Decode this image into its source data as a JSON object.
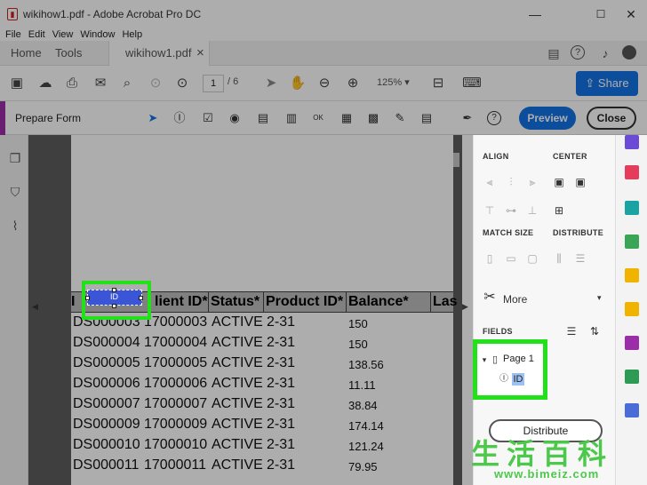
{
  "window": {
    "title": "wikihow1.pdf - Adobe Acrobat Pro DC",
    "minimize": "—",
    "maximize": "☐",
    "close": "✕"
  },
  "menu": [
    "File",
    "Edit",
    "View",
    "Window",
    "Help"
  ],
  "tabs": {
    "home": "Home",
    "tools": "Tools",
    "doc": "wikihow1.pdf",
    "doc_close": "×"
  },
  "toolbar": {
    "page_current": "1",
    "page_total": "/ 6",
    "zoom": "125%",
    "share": "Share"
  },
  "prepare": {
    "label": "Prepare Form",
    "preview": "Preview",
    "close": "Close"
  },
  "table": {
    "headers": [
      "ID",
      "Client ID*",
      "Status*",
      "Product ID*",
      "Balance*",
      "Las"
    ],
    "header_visible": {
      "client": "lient ID*",
      "first": "I"
    },
    "rows": [
      [
        "DS000003",
        "17000003",
        "ACTIVE",
        "2-31",
        "150"
      ],
      [
        "DS000004",
        "17000004",
        "ACTIVE",
        "2-31",
        "150"
      ],
      [
        "DS000005",
        "17000005",
        "ACTIVE",
        "2-31",
        "138.56"
      ],
      [
        "DS000006",
        "17000006",
        "ACTIVE",
        "2-31",
        "11.11"
      ],
      [
        "DS000007",
        "17000007",
        "ACTIVE",
        "2-31",
        "38.84"
      ],
      [
        "DS000009",
        "17000009",
        "ACTIVE",
        "2-31",
        "174.14"
      ],
      [
        "DS000010",
        "17000010",
        "ACTIVE",
        "2-31",
        "121.24"
      ],
      [
        "DS000011",
        "17000011",
        "ACTIVE",
        "2-31",
        "79.95"
      ]
    ]
  },
  "field": {
    "name": "ID"
  },
  "panel": {
    "align": "ALIGN",
    "center": "CENTER",
    "match_size": "MATCH SIZE",
    "distribute_label": "DISTRIBUTE",
    "more": "More",
    "fields": "FIELDS",
    "page_node": "Page 1",
    "field_node": "ID",
    "distribute_button": "Distribute"
  },
  "watermark": {
    "cn": "生活百科",
    "url": "www.bimeiz.com"
  },
  "colors": {
    "accent_blue": "#1473e6",
    "form_accent": "#9b2da8",
    "highlight_green": "#22e019"
  }
}
